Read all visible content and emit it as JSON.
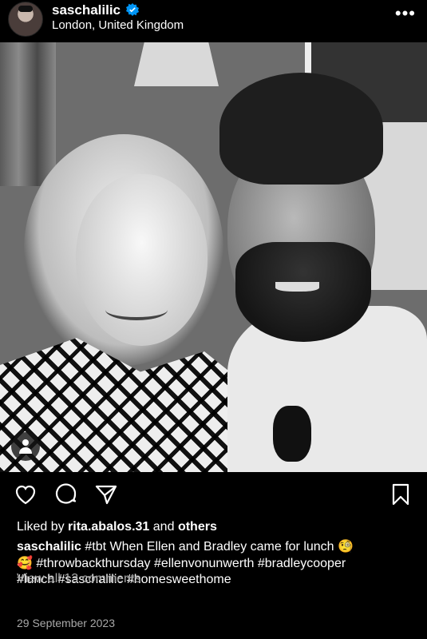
{
  "post": {
    "username": "saschalilic",
    "location": "London, United Kingdom",
    "more_icon": "more-horizontal-icon",
    "verified": true
  },
  "photo": {
    "tag_icon": "person-tag-icon"
  },
  "actions": {
    "like_icon": "heart-icon",
    "comment_icon": "comment-bubble-icon",
    "share_icon": "paper-plane-icon",
    "save_icon": "bookmark-icon"
  },
  "likes": {
    "prefix": "Liked by",
    "user": "rita.abalos.31",
    "joiner": "and",
    "others": "others"
  },
  "caption": {
    "username": "saschalilic",
    "text": "#tbt When Ellen and Bradley came for lunch 🧐",
    "line2": "🥰 #throwbackthursday #ellenvonunwerth #bradleycooper",
    "line3": "#lunch #saschalilic #homesweethome"
  },
  "comments": {
    "label": "View all 13 comments"
  },
  "date": "29 September 2023",
  "colors": {
    "background": "#000000",
    "text": "#ffffff",
    "muted": "#a8a8a8",
    "verified": "#0095f6"
  }
}
